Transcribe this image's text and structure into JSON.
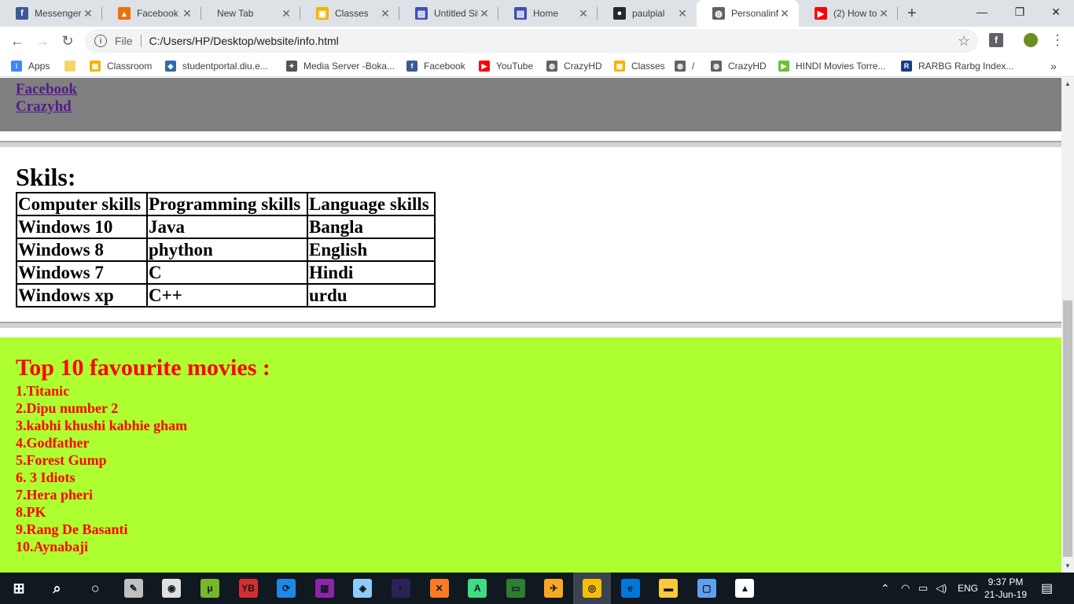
{
  "browser": {
    "tabs": [
      {
        "title": "Messenger",
        "icon": "facebook-icon",
        "color": "#3b5998",
        "glyph": "f"
      },
      {
        "title": "Facebook S",
        "icon": "chart-icon",
        "color": "#e8710a",
        "glyph": "▴"
      },
      {
        "title": "New Tab",
        "icon": "",
        "color": "",
        "glyph": ""
      },
      {
        "title": "Classes",
        "icon": "classroom-icon",
        "color": "#f4b400",
        "glyph": "▣"
      },
      {
        "title": "Untitled Site",
        "icon": "sites-icon",
        "color": "#3f51b5",
        "glyph": "▤"
      },
      {
        "title": "Home",
        "icon": "sites-icon",
        "color": "#3f51b5",
        "glyph": "▤"
      },
      {
        "title": "paulpial",
        "icon": "github-icon",
        "color": "#24292e",
        "glyph": "●"
      },
      {
        "title": "Personalinfo",
        "icon": "globe-icon",
        "color": "#5f6368",
        "glyph": "◍"
      },
      {
        "title": "(2) How to",
        "icon": "youtube-icon",
        "color": "#ff0000",
        "glyph": "▶"
      }
    ],
    "new_tab": "+",
    "controls": {
      "minimize": "—",
      "maximize": "❐",
      "close": "✕"
    },
    "address": {
      "scheme": "File",
      "url": "C:/Users/HP/Desktop/website/info.html"
    },
    "bookmarks": [
      {
        "label": "Apps",
        "icon": "apps-grid-icon",
        "color": "#4285f4",
        "glyph": "⁝"
      },
      {
        "label": "",
        "icon": "folder-icon",
        "color": "#f6d36b",
        "glyph": ""
      },
      {
        "label": "Classroom",
        "icon": "classroom-icon",
        "color": "#f4b400",
        "glyph": "▣"
      },
      {
        "label": "studentportal.diu.e...",
        "icon": "portal-icon",
        "color": "#2b6cb0",
        "glyph": "◆"
      },
      {
        "label": "Media Server -Boka...",
        "icon": "media-icon",
        "color": "#555555",
        "glyph": "✦"
      },
      {
        "label": "Facebook",
        "icon": "facebook-icon",
        "color": "#3b5998",
        "glyph": "f"
      },
      {
        "label": "YouTube",
        "icon": "youtube-icon",
        "color": "#ff0000",
        "glyph": "▶"
      },
      {
        "label": "CrazyHD",
        "icon": "globe-icon",
        "color": "#5f6368",
        "glyph": "◍"
      },
      {
        "label": "Classes",
        "icon": "classroom-icon",
        "color": "#f4b400",
        "glyph": "▣"
      },
      {
        "label": "/",
        "icon": "globe-icon",
        "color": "#5f6368",
        "glyph": "◍"
      },
      {
        "label": "CrazyHD",
        "icon": "globe-icon",
        "color": "#5f6368",
        "glyph": "◍"
      },
      {
        "label": "HINDI Movies Torre...",
        "icon": "play-icon",
        "color": "#6cbf3a",
        "glyph": "▶"
      },
      {
        "label": "RARBG Rarbg Index...",
        "icon": "rarbg-icon",
        "color": "#1a3c8f",
        "glyph": "R"
      }
    ],
    "more_bookmarks": "»"
  },
  "page": {
    "links": [
      "Facebook",
      "Crazyhd"
    ],
    "skills_title": "Skils:",
    "skills_table": {
      "headers": [
        "Computer skills",
        "Programming skills",
        "Language skills"
      ],
      "rows": [
        [
          "Windows 10",
          "Java",
          "Bangla"
        ],
        [
          "Windows 8",
          "phython",
          "English"
        ],
        [
          "Windows 7",
          "C",
          "Hindi"
        ],
        [
          "Windows xp",
          "C++",
          "urdu"
        ]
      ]
    },
    "movies_title": "Top 10 favourite movies :",
    "movies": [
      "1.Titanic",
      "2.Dipu number 2",
      "3.kabhi khushi kabhie gham",
      "4.Godfather",
      "5.Forest Gump",
      "6. 3 Idiots",
      "7.Hera pheri",
      "8.PK",
      "9.Rang De Basanti",
      "10.Aynabaji"
    ],
    "colors": {
      "links_bg": "#808080",
      "movies_bg": "#adff2f",
      "movies_text": "#ff0000",
      "link": "#551a8b"
    }
  },
  "taskbar": {
    "items": [
      {
        "name": "start-icon",
        "color": "#ffffff",
        "glyph": "⊞"
      },
      {
        "name": "search-icon",
        "color": "#ffffff",
        "glyph": "⌕"
      },
      {
        "name": "task-view-icon",
        "color": "#ffffff",
        "glyph": "○"
      },
      {
        "name": "paint-icon",
        "color": "#c0c0c0",
        "glyph": "✎"
      },
      {
        "name": "camera-icon",
        "color": "#e0e0e0",
        "glyph": "◉"
      },
      {
        "name": "utorrent-icon",
        "color": "#76b82a",
        "glyph": "μ"
      },
      {
        "name": "yb-icon",
        "color": "#d32f2f",
        "glyph": "YB"
      },
      {
        "name": "sync-icon",
        "color": "#1e88e5",
        "glyph": "⟳"
      },
      {
        "name": "winrar-icon",
        "color": "#8e24aa",
        "glyph": "▦"
      },
      {
        "name": "box-icon",
        "color": "#90caf9",
        "glyph": "◈"
      },
      {
        "name": "eclipse-icon",
        "color": "#2c2255",
        "glyph": "◐"
      },
      {
        "name": "xampp-icon",
        "color": "#fb7a24",
        "glyph": "✕"
      },
      {
        "name": "android-studio-icon",
        "color": "#3ddc84",
        "glyph": "A"
      },
      {
        "name": "terminal-icon",
        "color": "#2e7d32",
        "glyph": "▭"
      },
      {
        "name": "tool-icon",
        "color": "#f9a825",
        "glyph": "✈"
      },
      {
        "name": "chrome-icon",
        "color": "#fbbc05",
        "glyph": "◎"
      },
      {
        "name": "edge-icon",
        "color": "#0078d7",
        "glyph": "e"
      },
      {
        "name": "file-explorer-icon",
        "color": "#ffc83d",
        "glyph": "▬"
      },
      {
        "name": "app-icon",
        "color": "#5ea0ef",
        "glyph": "▢"
      },
      {
        "name": "photos-icon",
        "color": "#ffffff",
        "glyph": "▲"
      }
    ],
    "language": "ENG",
    "time": "9:37 PM",
    "date": "21-Jun-19"
  }
}
